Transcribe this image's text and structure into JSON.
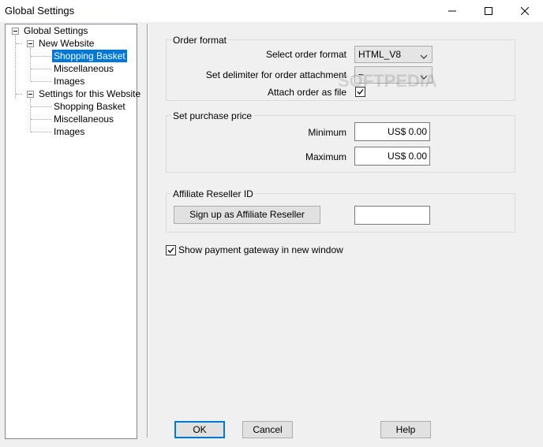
{
  "window": {
    "title": "Global Settings",
    "buttons": [
      "minimize-icon",
      "maximize-icon",
      "close-icon"
    ]
  },
  "tree": {
    "root": "Global Settings",
    "groups": [
      {
        "label": "New Website",
        "items": [
          "Shopping Basket",
          "Miscellaneous",
          "Images"
        ],
        "selected": "Shopping Basket"
      },
      {
        "label": "Settings for this Website",
        "items": [
          "Shopping Basket",
          "Miscellaneous",
          "Images"
        ]
      }
    ]
  },
  "order_format": {
    "title": "Order format",
    "select_label": "Select order format",
    "select_value": "HTML_V8",
    "delimiter_label": "Set delimiter for order attachment",
    "delimiter_value": "~",
    "attach_label": "Attach order as file",
    "attach_checked": true
  },
  "purchase_price": {
    "title": "Set purchase price",
    "min_label": "Minimum",
    "min_value": "US$ 0.00",
    "max_label": "Maximum",
    "max_value": "US$ 0.00"
  },
  "affiliate": {
    "title": "Affiliate Reseller ID",
    "signup_label": "Sign up as Affiliate Reseller",
    "id_value": ""
  },
  "payment_gateway": {
    "label": "Show payment gateway in new window",
    "checked": true
  },
  "footer": {
    "ok": "OK",
    "cancel": "Cancel",
    "help": "Help"
  }
}
